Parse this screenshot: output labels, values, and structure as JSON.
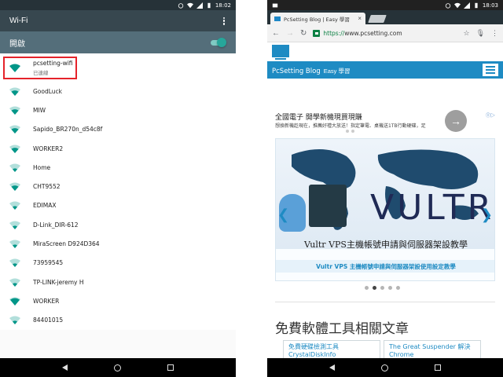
{
  "left_phone": {
    "status": {
      "time": "18:02"
    },
    "toolbar": {
      "title": "Wi-Fi"
    },
    "toggle": {
      "label": "開啟",
      "on": true
    },
    "connected": {
      "name": "pcsetting-wifi",
      "status": "已連線"
    },
    "networks": [
      "GoodLuck",
      "MIW",
      "Sapido_BR270n_d54c8f",
      "WORKER2",
      "Home",
      "CHT9552",
      "EDIMAX",
      "D-Link_DIR-612",
      "MiraScreen D924D364",
      "73959545",
      "TP-LINK-jeremy H",
      "WORKER",
      "84401015"
    ]
  },
  "right_phone": {
    "status": {
      "time": "18:03"
    },
    "tab": {
      "title": "PcSetting Blog | Easy 學習",
      "close": "×"
    },
    "address": {
      "scheme": "https://",
      "host": "www.pcsetting.com"
    },
    "site": {
      "name": "PcSetting Blog",
      "sub": "Easy 學習"
    },
    "ad": {
      "title": "全國電子 開學新機現買現賺",
      "desc": "想換新機趁現在，推薦好禮大放送！指定筆電、桌機送1TB行動硬碟，足",
      "choice": "Ⓘ▷"
    },
    "banner": {
      "brand": "VULTR",
      "caption": "Vultr VPS主機帳號申請與伺服器架設教學",
      "link": "Vultr VPS 主機帳號申請與伺服器架設使用設定教學"
    },
    "carousel": {
      "count": 5,
      "active": 1
    },
    "section_title": "免費軟體工具相關文章",
    "related": [
      "免費硬碟檢測工具 CrystalDiskInfo",
      "The Great Suspender 解決 Chrome"
    ],
    "watermark": "www.pcsetting.com"
  },
  "colors": {
    "connected_icon": "#009688",
    "idle_icon": "#26a69a",
    "brand_blue": "#1e8bc3",
    "highlight": "#e5232a"
  }
}
